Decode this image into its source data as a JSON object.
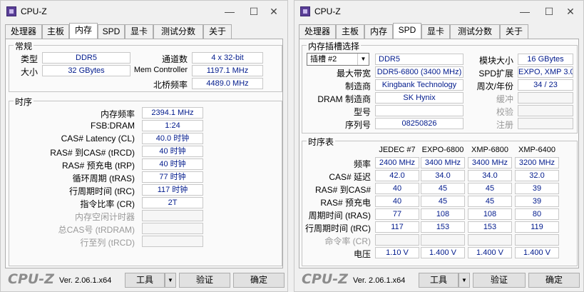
{
  "app_name": "CPU-Z",
  "window_controls": {
    "minimize": "—",
    "maximize": "☐",
    "close": "✕"
  },
  "tabs": [
    "处理器",
    "主板",
    "内存",
    "SPD",
    "显卡",
    "测试分数",
    "关于"
  ],
  "left": {
    "active_tab": "内存",
    "general": {
      "title": "常规",
      "type_label": "类型",
      "type_value": "DDR5",
      "size_label": "大小",
      "size_value": "32 GBytes",
      "channels_label": "通道数",
      "channels_value": "4 x 32-bit",
      "memctrl_label": "Mem Controller",
      "memctrl_value": "1197.1 MHz",
      "nb_label": "北桥频率",
      "nb_value": "4489.0 MHz"
    },
    "timings": {
      "title": "时序",
      "rows": [
        {
          "label": "内存频率",
          "value": "2394.1 MHz",
          "dim": false
        },
        {
          "label": "FSB:DRAM",
          "value": "1:24",
          "dim": false
        },
        {
          "label": "CAS# Latency (CL)",
          "value": "40.0 时钟",
          "dim": false
        },
        {
          "label": "RAS# 到CAS# (tRCD)",
          "value": "40 时钟",
          "dim": false
        },
        {
          "label": "RAS# 预充电 (tRP)",
          "value": "40 时钟",
          "dim": false
        },
        {
          "label": "循环周期 (tRAS)",
          "value": "77 时钟",
          "dim": false
        },
        {
          "label": "行周期时间 (tRC)",
          "value": "117 时钟",
          "dim": false
        },
        {
          "label": "指令比率 (CR)",
          "value": "2T",
          "dim": false
        },
        {
          "label": "内存空闲计时器",
          "value": "",
          "dim": true
        },
        {
          "label": "总CAS号 (tRDRAM)",
          "value": "",
          "dim": true
        },
        {
          "label": "行至列 (tRCD)",
          "value": "",
          "dim": true
        }
      ]
    }
  },
  "right": {
    "active_tab": "SPD",
    "slot": {
      "title": "内存插槽选择",
      "selected_slot": "插槽 #2",
      "type_value": "DDR5",
      "module_size_label": "模块大小",
      "module_size_value": "16 GBytes",
      "max_bw_label": "最大带宽",
      "max_bw_value": "DDR5-6800 (3400 MHz)",
      "spd_ext_label": "SPD扩展",
      "spd_ext_value": "EXPO, XMP 3.0",
      "mfr_label": "制造商",
      "mfr_value": "Kingbank Technology",
      "week_label": "周次/年份",
      "week_value": "34 / 23",
      "dram_mfr_label": "DRAM 制造商",
      "dram_mfr_value": "SK Hynix",
      "buffer_label": "缓冲",
      "part_label": "型号",
      "check_label": "校验",
      "serial_label": "序列号",
      "serial_value": "08250826",
      "reg_label": "注册"
    },
    "timing_table": {
      "title": "时序表",
      "headers": [
        "JEDEC #7",
        "EXPO-6800",
        "XMP-6800",
        "XMP-6400"
      ],
      "rows": [
        {
          "label": "频率",
          "values": [
            "2400 MHz",
            "3400 MHz",
            "3400 MHz",
            "3200 MHz"
          ],
          "dim": false
        },
        {
          "label": "CAS# 延迟",
          "values": [
            "42.0",
            "34.0",
            "34.0",
            "32.0"
          ],
          "dim": false
        },
        {
          "label": "RAS# 到CAS#",
          "values": [
            "40",
            "45",
            "45",
            "39"
          ],
          "dim": false
        },
        {
          "label": "RAS# 预充电",
          "values": [
            "40",
            "45",
            "45",
            "39"
          ],
          "dim": false
        },
        {
          "label": "周期时间 (tRAS)",
          "values": [
            "77",
            "108",
            "108",
            "80"
          ],
          "dim": false
        },
        {
          "label": "行周期时间 (tRC)",
          "values": [
            "117",
            "153",
            "153",
            "119"
          ],
          "dim": false
        },
        {
          "label": "命令率 (CR)",
          "values": [
            "",
            "",
            "",
            ""
          ],
          "dim": true
        },
        {
          "label": "电压",
          "values": [
            "1.10 V",
            "1.400 V",
            "1.400 V",
            "1.400 V"
          ],
          "dim": false
        }
      ]
    }
  },
  "footer": {
    "brand": "CPU-Z",
    "version": "Ver. 2.06.1.x64",
    "tools_label": "工具",
    "dropdown_arrow": "▼",
    "validate_label": "验证",
    "ok_label": "确定"
  }
}
